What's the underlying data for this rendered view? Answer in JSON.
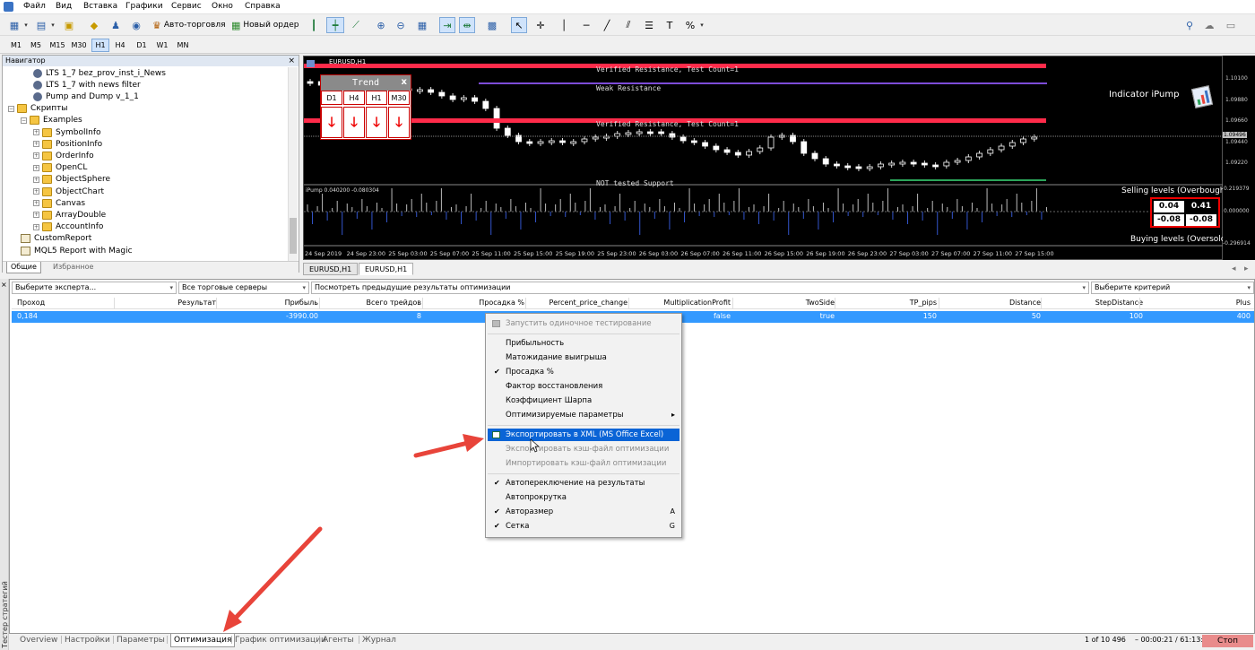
{
  "menu": {
    "items": [
      "Файл",
      "Вид",
      "Вставка",
      "Графики",
      "Сервис",
      "Окно",
      "Справка"
    ]
  },
  "toolbar": {
    "autotrade_label": "Авто-торговля",
    "neworder_label": "Новый ордер"
  },
  "timeframes": [
    "M1",
    "M5",
    "M15",
    "M30",
    "H1",
    "H4",
    "D1",
    "W1",
    "MN"
  ],
  "active_timeframe": "H1",
  "navigator": {
    "title": "Навигатор",
    "close": "×",
    "rows": [
      {
        "label": "LTS 1_7 bez_prov_inst_i_News",
        "icon": "expert-icon",
        "indent": 2
      },
      {
        "label": "LTS 1_7 with news filter",
        "icon": "expert-icon",
        "indent": 2
      },
      {
        "label": "Pump and Dump v_1_1",
        "icon": "expert-icon",
        "indent": 2
      },
      {
        "label": "Скрипты",
        "icon": "folder-icon",
        "indent": 0,
        "toggle": "−"
      },
      {
        "label": "Examples",
        "icon": "folder-icon",
        "indent": 1,
        "toggle": "−"
      },
      {
        "label": "SymbolInfo",
        "icon": "folder-icon",
        "indent": 2,
        "toggle": "+"
      },
      {
        "label": "PositionInfo",
        "icon": "folder-icon",
        "indent": 2,
        "toggle": "+"
      },
      {
        "label": "OrderInfo",
        "icon": "folder-icon",
        "indent": 2,
        "toggle": "+"
      },
      {
        "label": "OpenCL",
        "icon": "folder-icon",
        "indent": 2,
        "toggle": "+"
      },
      {
        "label": "ObjectSphere",
        "icon": "folder-icon",
        "indent": 2,
        "toggle": "+"
      },
      {
        "label": "ObjectChart",
        "icon": "folder-icon",
        "indent": 2,
        "toggle": "+"
      },
      {
        "label": "Canvas",
        "icon": "folder-icon",
        "indent": 2,
        "toggle": "+"
      },
      {
        "label": "ArrayDouble",
        "icon": "folder-icon",
        "indent": 2,
        "toggle": "+"
      },
      {
        "label": "AccountInfo",
        "icon": "folder-icon",
        "indent": 2,
        "toggle": "+"
      },
      {
        "label": "CustomReport",
        "icon": "script-icon",
        "indent": 1
      },
      {
        "label": "MQL5 Report with Magic",
        "icon": "script-icon",
        "indent": 1
      }
    ],
    "tabs": [
      "Общие",
      "Избранное"
    ]
  },
  "chart": {
    "symbol": "EURUSD,H1",
    "levels": {
      "resistance_top": "Verified Resistance, Test Count=1",
      "weak_resistance": "Weak Resistance",
      "resistance_mid": "Verified Resistance, Test Count=1",
      "support": "NOT tested Support"
    },
    "trend_panel": {
      "title": "Trend",
      "close": "x",
      "timeframes": [
        "D1",
        "H4",
        "H1",
        "M30"
      ],
      "arrow": "🡓"
    },
    "indicator_label": "Indicator iPump",
    "indicator_brand": "iPump",
    "price_axis": [
      "1.10100",
      "1.09880",
      "1.09660",
      "1.09440",
      "1.09220"
    ],
    "current_price": "1.09496",
    "sub_window": {
      "label": "iPump 0.040200 -0.080304",
      "axis": [
        "0.219379",
        "0.000000",
        "-0.296914"
      ],
      "selling_label": "Selling levels (Overbought)",
      "buying_label": "Buying levels (Oversold)",
      "sell_values": [
        "0.04",
        "0.41"
      ],
      "buy_values": [
        "-0.08",
        "-0.08"
      ]
    },
    "time_axis": [
      "24 Sep 2019",
      "24 Sep 23:00",
      "25 Sep 03:00",
      "25 Sep 07:00",
      "25 Sep 11:00",
      "25 Sep 15:00",
      "25 Sep 19:00",
      "25 Sep 23:00",
      "26 Sep 03:00",
      "26 Sep 07:00",
      "26 Sep 11:00",
      "26 Sep 15:00",
      "26 Sep 19:00",
      "26 Sep 23:00",
      "27 Sep 03:00",
      "27 Sep 07:00",
      "27 Sep 11:00",
      "27 Sep 15:00"
    ],
    "tabs": [
      "EURUSD,H1",
      "EURUSD,H1"
    ]
  },
  "tester": {
    "filters": {
      "expert": "Выберите эксперта...",
      "servers": "Все торговые серверы",
      "history": "Посмотреть предыдущие результаты оптимизации",
      "criterion": "Выберите критерий"
    },
    "columns": [
      "Проход",
      "Результат",
      "Прибыль",
      "Всего трейдов",
      "Просадка %",
      "Percent_price_change",
      "MultiplicationProfit",
      "TwoSide",
      "TP_pips",
      "Distance",
      "StepDistance",
      "Plus"
    ],
    "row": [
      "0,184",
      "",
      "-3990.00",
      "8",
      "",
      "",
      "false",
      "true",
      "150",
      "50",
      "100",
      "400"
    ],
    "sidebar_label": "Тестер стратегий"
  },
  "context_menu": {
    "items": [
      {
        "label": "Запустить одиночное тестирование",
        "state": "disabled",
        "check": "",
        "shortcut": ""
      },
      {
        "sep": true
      },
      {
        "label": "Прибыльность",
        "state": "normal",
        "check": "",
        "shortcut": ""
      },
      {
        "label": "Матожидание выигрыша",
        "state": "normal",
        "check": "",
        "shortcut": ""
      },
      {
        "label": "Просадка %",
        "state": "normal",
        "check": "✔",
        "shortcut": ""
      },
      {
        "label": "Фактор восстановления",
        "state": "normal",
        "check": "",
        "shortcut": ""
      },
      {
        "label": "Коэффициент Шарпа",
        "state": "normal",
        "check": "",
        "shortcut": ""
      },
      {
        "label": "Оптимизируемые параметры",
        "state": "normal",
        "check": "",
        "shortcut": "▸"
      },
      {
        "sep": true
      },
      {
        "label": "Экспортировать в XML (MS Office Excel)",
        "state": "highlight",
        "check": "",
        "shortcut": ""
      },
      {
        "label": "Экспортировать кэш-файл оптимизации",
        "state": "disabled",
        "check": "",
        "shortcut": ""
      },
      {
        "label": "Импортировать кэш-файл оптимизации",
        "state": "disabled",
        "check": "",
        "shortcut": ""
      },
      {
        "sep": true
      },
      {
        "label": "Автопереключение на результаты",
        "state": "normal",
        "check": "✔",
        "shortcut": ""
      },
      {
        "label": "Автопрокрутка",
        "state": "normal",
        "check": "",
        "shortcut": ""
      },
      {
        "label": "Авторазмер",
        "state": "normal",
        "check": "✔",
        "shortcut": "A"
      },
      {
        "label": "Сетка",
        "state": "normal",
        "check": "✔",
        "shortcut": "G"
      }
    ]
  },
  "bottom_tabs": [
    "Overview",
    "Настройки",
    "Параметры",
    "Оптимизация",
    "График оптимизации",
    "Агенты",
    "Журнал"
  ],
  "active_bottom_tab": "Оптимизация",
  "status": {
    "progress_text": "1 of 10 496",
    "time_text": "00:00:21 / 61:13:36",
    "stop_label": "Стоп"
  },
  "colors": {
    "selection": "#3399ff",
    "menu_highlight": "#0a64d6",
    "arrow_red": "#e8443a",
    "level_red": "#ff2b4a",
    "level_purple": "#7d4cd8",
    "level_green": "#2ca45a"
  }
}
